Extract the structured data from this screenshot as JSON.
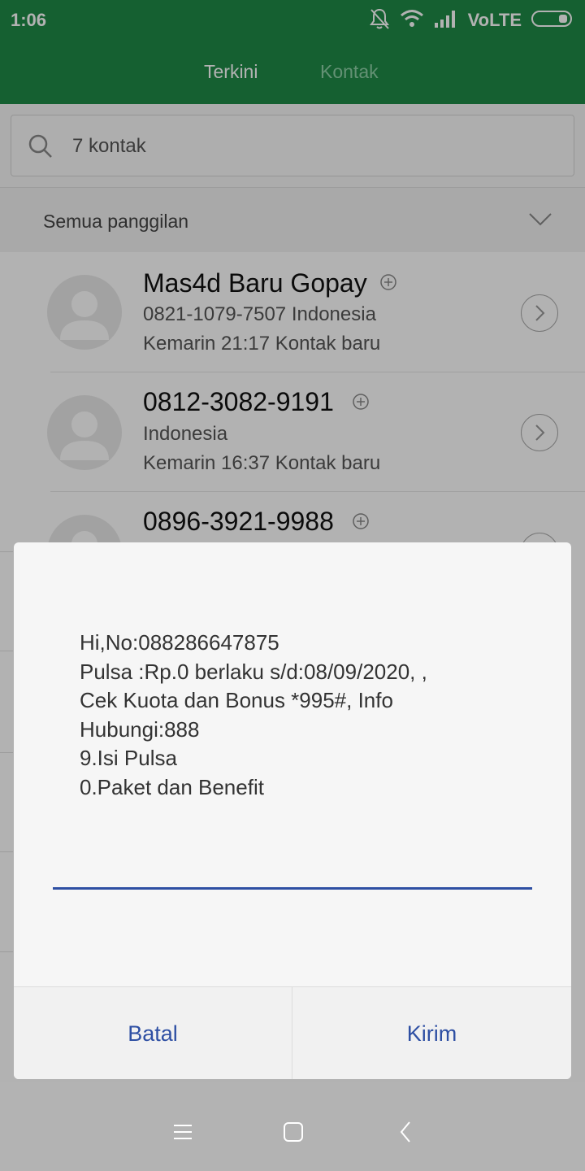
{
  "status_bar": {
    "time": "1:06",
    "network": "VoLTE"
  },
  "tabs": [
    {
      "label": "Terkini",
      "active": true
    },
    {
      "label": "Kontak",
      "active": false
    }
  ],
  "search": {
    "placeholder": "7 kontak"
  },
  "filter": {
    "label": "Semua panggilan"
  },
  "call_log": [
    {
      "name": "Mas4d Baru Gopay",
      "line1": "0821-1079-7507  Indonesia",
      "line2": "Kemarin 21:17 Kontak baru"
    },
    {
      "name": "0812-3082-9191",
      "line1": "Indonesia",
      "line2": "Kemarin 16:37 Kontak baru"
    },
    {
      "name": "0896-3921-9988",
      "line1": "",
      "line2": ""
    }
  ],
  "dialog": {
    "message_lines": [
      "Hi,No:088286647875",
      "Pulsa :Rp.0 berlaku s/d:08/09/2020, ,",
      "Cek Kuota dan Bonus *995#, Info",
      "Hubungi:888",
      "9.Isi Pulsa",
      "0.Paket dan Benefit"
    ],
    "reply_value": "",
    "cancel_label": "Batal",
    "send_label": "Kirim"
  },
  "colors": {
    "header": "#1f8a47",
    "accent": "#2e4fa3"
  },
  "icons": [
    "mute-icon",
    "wifi-icon",
    "signal-icon",
    "battery-icon",
    "search-icon",
    "chevron-down-icon",
    "person-avatar-icon",
    "add-circle-icon",
    "chevron-right-icon",
    "menu-icon",
    "home-icon",
    "back-icon"
  ]
}
